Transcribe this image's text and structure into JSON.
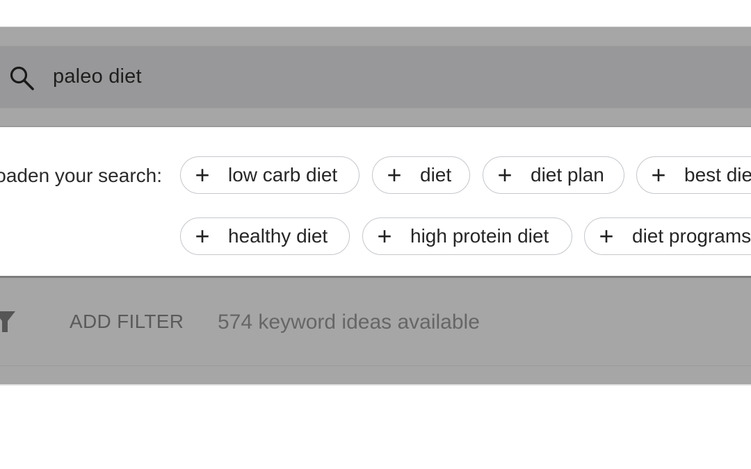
{
  "search": {
    "query": "paleo diet",
    "icon": "search-icon"
  },
  "broaden": {
    "label": "Broaden your search:",
    "chips": [
      {
        "label": "low carb diet",
        "icon": "plus-icon"
      },
      {
        "label": "diet",
        "icon": "plus-icon"
      },
      {
        "label": "diet plan",
        "icon": "plus-icon"
      },
      {
        "label": "best diet",
        "icon": "plus-icon"
      },
      {
        "label": "healthy diet",
        "icon": "plus-icon"
      },
      {
        "label": "high protein diet",
        "icon": "plus-icon"
      },
      {
        "label": "diet programs",
        "icon": "plus-icon"
      }
    ],
    "plus_glyph": "+"
  },
  "toolbar": {
    "filter_icon": "filter-icon",
    "add_filter_label": "ADD FILTER",
    "ideas_count_text": "574 keyword ideas available"
  }
}
